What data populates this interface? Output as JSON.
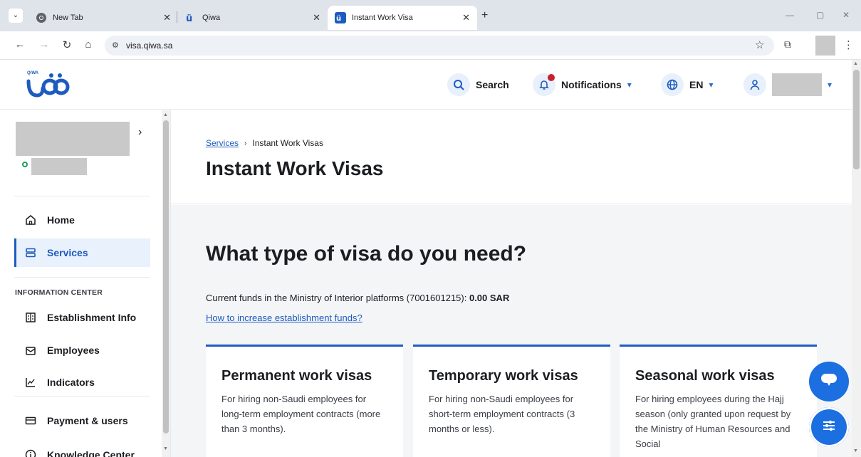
{
  "browser": {
    "tabs": [
      {
        "title": "New Tab"
      },
      {
        "title": "Qiwa"
      },
      {
        "title": "Instant Work Visa"
      }
    ],
    "url": "visa.qiwa.sa"
  },
  "header": {
    "logo_text": "QIWA",
    "search_label": "Search",
    "notifications_label": "Notifications",
    "language_label": "EN"
  },
  "sidebar": {
    "items": [
      {
        "label": "Home",
        "icon": "home-icon"
      },
      {
        "label": "Services",
        "icon": "services-icon",
        "active": true
      }
    ],
    "section_title": "INFORMATION CENTER",
    "info_items": [
      {
        "label": "Establishment Info",
        "icon": "building-icon"
      },
      {
        "label": "Employees",
        "icon": "employees-icon"
      },
      {
        "label": "Indicators",
        "icon": "chart-icon"
      },
      {
        "label": "Payment & users",
        "icon": "card-icon"
      },
      {
        "label": "Knowledge Center",
        "icon": "info-icon"
      }
    ]
  },
  "main": {
    "breadcrumb": {
      "parent": "Services",
      "current": "Instant Work Visas"
    },
    "title": "Instant Work Visas",
    "question": "What type of visa do you need?",
    "funds_text": "Current funds in the Ministry of Interior platforms (7001601215):",
    "funds_value": "0.00 SAR",
    "funds_link": "How to increase establishment funds?",
    "cards": [
      {
        "title": "Permanent work visas",
        "desc": "For hiring non-Saudi employees for long-term employment contracts (more than 3 months)."
      },
      {
        "title": "Temporary work visas",
        "desc": "For hiring non-Saudi employees for short-term employment contracts (3 months or less)."
      },
      {
        "title": "Seasonal work visas",
        "desc": "For hiring employees during the Hajj season (only granted upon request by the Ministry of Human Resources and Social"
      }
    ]
  },
  "colors": {
    "accent": "#1d5bbf",
    "fab": "#1b6fe0",
    "alert": "#c7212f",
    "online": "#1e9e5a"
  }
}
